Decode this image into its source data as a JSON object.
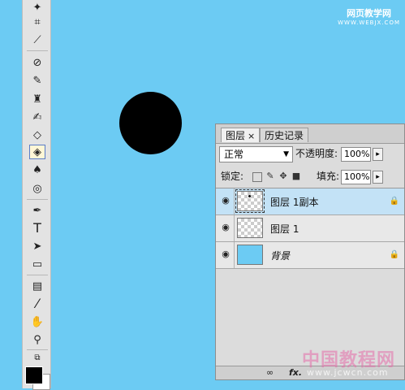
{
  "watermark_top": {
    "line1": "网页教学网",
    "line2": "WWW.WEBJX.COM"
  },
  "watermark_bottom": {
    "line1": "中国教程网",
    "line2": "www.jcwcn.com"
  },
  "tools": [
    {
      "name": "magic-wand-icon",
      "glyph": "✦"
    },
    {
      "name": "crop-icon",
      "glyph": "⌗"
    },
    {
      "name": "slice-icon",
      "glyph": "⟋"
    },
    {
      "name": "healing-brush-icon",
      "glyph": "⊘"
    },
    {
      "name": "brush-icon",
      "glyph": "✎"
    },
    {
      "name": "clone-stamp-icon",
      "glyph": "♜"
    },
    {
      "name": "history-brush-icon",
      "glyph": "✍"
    },
    {
      "name": "eraser-icon",
      "glyph": "◇"
    },
    {
      "name": "paint-bucket-icon",
      "glyph": "◈"
    },
    {
      "name": "blur-icon",
      "glyph": "♠"
    },
    {
      "name": "dodge-icon",
      "glyph": "◎"
    },
    {
      "name": "pen-icon",
      "glyph": "✒"
    },
    {
      "name": "type-icon",
      "glyph": "T"
    },
    {
      "name": "path-selection-icon",
      "glyph": "➤"
    },
    {
      "name": "rectangle-shape-icon",
      "glyph": "▭"
    },
    {
      "name": "notes-icon",
      "glyph": "▤"
    },
    {
      "name": "eyedropper-icon",
      "glyph": "⁄"
    },
    {
      "name": "hand-icon",
      "glyph": "✋"
    },
    {
      "name": "zoom-icon",
      "glyph": "⚲"
    },
    {
      "name": "default-colors-icon",
      "glyph": "⧉"
    }
  ],
  "panel": {
    "tabs": [
      {
        "label": "图层",
        "close": "×"
      },
      {
        "label": "历史记录"
      }
    ],
    "blend_mode": "正常",
    "opacity_label": "不透明度:",
    "opacity_value": "100%",
    "lock_label": "锁定:",
    "fill_label": "填充:",
    "fill_value": "100%",
    "layers": [
      {
        "name": "图层 1副本",
        "selected": true,
        "locked": true
      },
      {
        "name": "图层 1",
        "selected": false,
        "locked": false
      },
      {
        "name": "背景",
        "selected": false,
        "locked": true
      }
    ],
    "footer": {
      "link": "∞",
      "fx": "fx."
    }
  },
  "colors": {
    "canvas": "#6ccbf3",
    "foreground": "#000000",
    "background": "#ffffff"
  }
}
